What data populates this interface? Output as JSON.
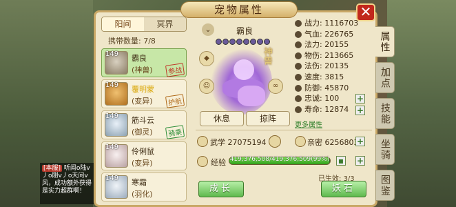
{
  "window": {
    "title": "宠物属性",
    "close_glyph": "✕"
  },
  "left_tabs": {
    "yang": "阳间",
    "ming": "冥界"
  },
  "carry": {
    "label": "携带数量:",
    "value": "7/8"
  },
  "pets": [
    {
      "level": "149",
      "name": "霸良",
      "type": "(神兽)",
      "stamp": "参战",
      "selected": true
    },
    {
      "level": "149",
      "name": "覆明蒙",
      "type": "(变异)",
      "stamp": "护航",
      "selected": false
    },
    {
      "level": "149",
      "name": "筋斗云",
      "type": "(御灵)",
      "stamp": "骑乘",
      "selected": false
    },
    {
      "level": "149",
      "name": "伶俐鼠",
      "type": "(变异)",
      "stamp": "",
      "selected": false
    },
    {
      "level": "149",
      "name": "寒霜",
      "type": "(羽化)",
      "stamp": "",
      "selected": false
    }
  ],
  "current_pet": {
    "name": "霸良",
    "god_label": "神兽"
  },
  "actions": {
    "rest": "休息",
    "formation": "掠阵"
  },
  "stats": [
    {
      "label": "战力:",
      "value": "1116703"
    },
    {
      "label": "气血:",
      "value": "226765"
    },
    {
      "label": "法力:",
      "value": "20155"
    },
    {
      "label": "物伤:",
      "value": "213665"
    },
    {
      "label": "法伤:",
      "value": "20135"
    },
    {
      "label": "速度:",
      "value": "3815"
    },
    {
      "label": "防御:",
      "value": "45870"
    },
    {
      "label": "忠诚:",
      "value": "100"
    },
    {
      "label": "寿命:",
      "value": "12874"
    }
  ],
  "more_attrs": "更多属性",
  "wuxue": {
    "label": "武学",
    "value": "27075194"
  },
  "qinmi": {
    "label": "亲密",
    "value": "6256803"
  },
  "exp": {
    "label": "经验",
    "text": "419,376,508/419,376,509(99%)",
    "fraction": 0.99
  },
  "effect": {
    "label": "已生效:",
    "value": "3/3"
  },
  "bottom_buttons": {
    "grow": "成长",
    "stone": "妖石"
  },
  "side_tabs": [
    "属性",
    "加点",
    "技能",
    "坐骑",
    "图鉴"
  ],
  "chat": {
    "tag": "[本服]",
    "text": "听闻o陆v丿o刚v丿o天问v风，成功额外获得是实力超群啊！"
  }
}
